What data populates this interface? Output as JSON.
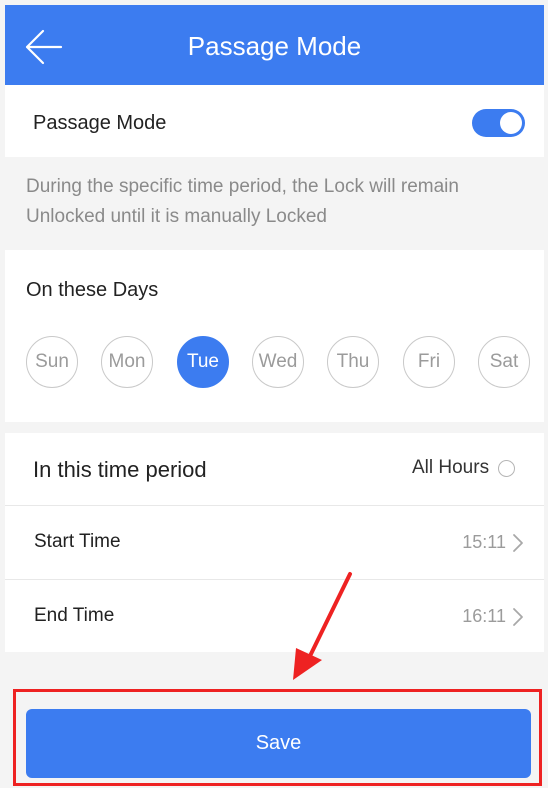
{
  "header": {
    "title": "Passage Mode",
    "back_icon": "arrow-left-icon"
  },
  "passage_mode": {
    "label": "Passage Mode",
    "enabled": true,
    "description": "During the specific time period, the Lock will remain Unlocked until it is manually Locked"
  },
  "days": {
    "title": "On these Days",
    "items": [
      {
        "label": "Sun",
        "selected": false
      },
      {
        "label": "Mon",
        "selected": false
      },
      {
        "label": "Tue",
        "selected": true
      },
      {
        "label": "Wed",
        "selected": false
      },
      {
        "label": "Thu",
        "selected": false
      },
      {
        "label": "Fri",
        "selected": false
      },
      {
        "label": "Sat",
        "selected": false
      }
    ]
  },
  "time_period": {
    "title": "In this time period",
    "all_hours_label": "All Hours",
    "all_hours_checked": false,
    "start_label": "Start Time",
    "start_value": "15:11",
    "end_label": "End Time",
    "end_value": "16:11"
  },
  "save_label": "Save",
  "colors": {
    "accent": "#3c7cf0",
    "annotation": "#ee2222",
    "background": "#f4f4f4"
  }
}
